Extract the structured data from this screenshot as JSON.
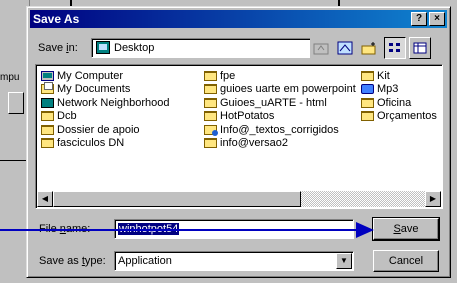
{
  "background": {
    "fragment_text": "mpu"
  },
  "dialog": {
    "title": "Save As",
    "help_label": "?",
    "close_label": "×"
  },
  "save_in": {
    "label_prefix": "Save ",
    "label_hot": "i",
    "label_suffix": "n:",
    "value": "Desktop"
  },
  "toolbar": {
    "buttons": [
      "up-one-level",
      "desktop",
      "new-folder",
      "list-view",
      "details-view"
    ]
  },
  "files": {
    "column1": [
      {
        "icon": "computer",
        "label": "My Computer"
      },
      {
        "icon": "documents",
        "label": "My Documents"
      },
      {
        "icon": "network",
        "label": "Network Neighborhood"
      },
      {
        "icon": "folder",
        "label": "Dcb"
      },
      {
        "icon": "folder",
        "label": "Dossier de apoio"
      },
      {
        "icon": "folder",
        "label": "fasciculos DN"
      }
    ],
    "column2": [
      {
        "icon": "folder",
        "label": "fpe"
      },
      {
        "icon": "folder",
        "label": "guioes uarte em powerpoint"
      },
      {
        "icon": "folder",
        "label": "Guioes_uARTE - html"
      },
      {
        "icon": "folder",
        "label": "HotPotatos"
      },
      {
        "icon": "web-folder",
        "label": "Info@_textos_corrigidos"
      },
      {
        "icon": "folder",
        "label": "info@versao2"
      }
    ],
    "column3": [
      {
        "icon": "folder",
        "label": "Kit"
      },
      {
        "icon": "music",
        "label": "Mp3"
      },
      {
        "icon": "folder",
        "label": "Oficina"
      },
      {
        "icon": "folder",
        "label": "Orçamentos"
      }
    ]
  },
  "file_name": {
    "label_prefix": "File ",
    "label_hot": "n",
    "label_suffix": "ame:",
    "value": "winhotpot54"
  },
  "save_as_type": {
    "label_prefix": "Save as ",
    "label_hot": "t",
    "label_suffix": "ype:",
    "value": "Application"
  },
  "buttons": {
    "save_hot": "S",
    "save_rest": "ave",
    "cancel": "Cancel"
  },
  "annotation": {
    "color": "#0000c0"
  }
}
